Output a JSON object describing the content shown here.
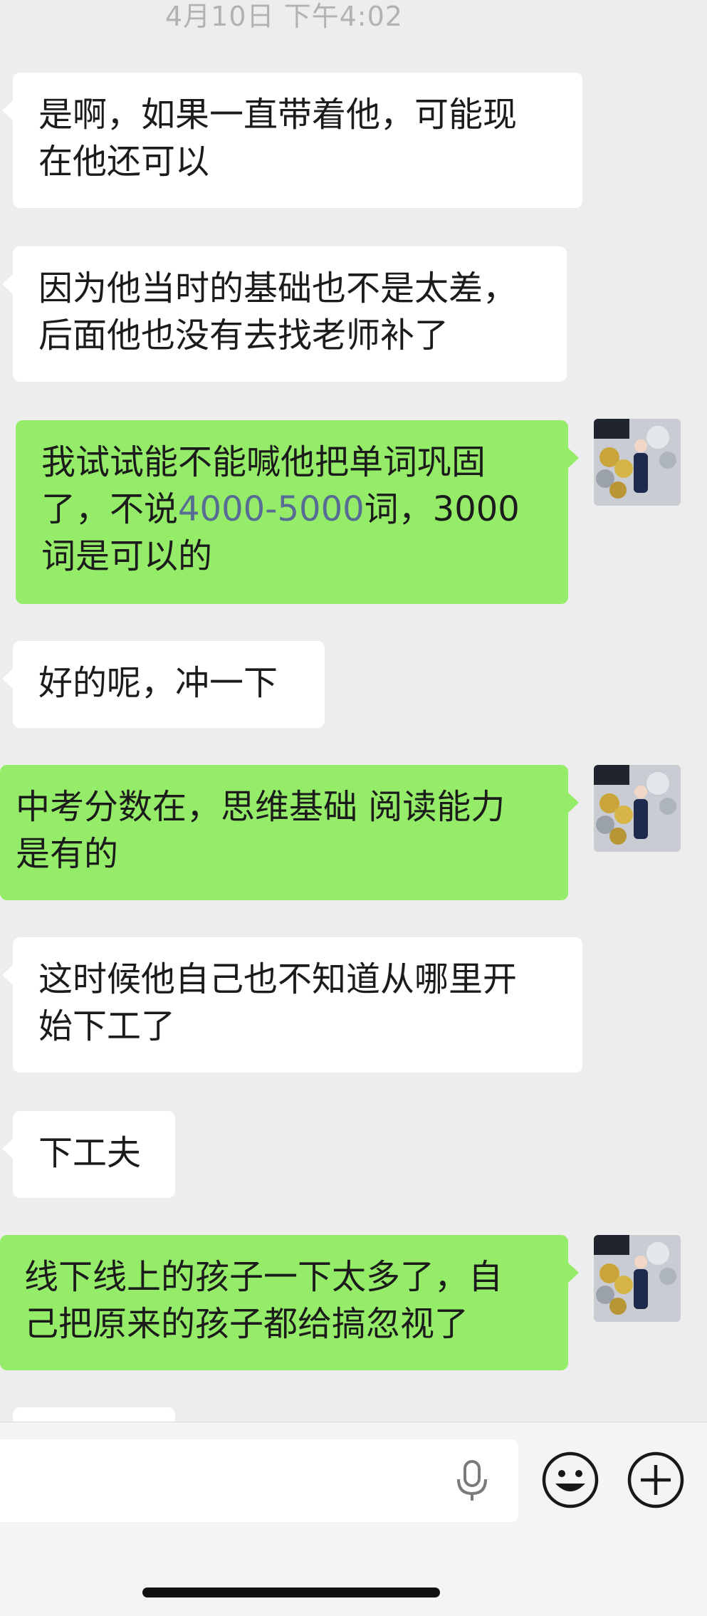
{
  "header": {
    "timestamp": "4月10日 下午4:02"
  },
  "messages": [
    {
      "side": "left",
      "text": "是啊，如果一直带着他，可能现\n在他还可以"
    },
    {
      "side": "left",
      "text": "因为他当时的基础也不是太差，\n后面他也没有去找老师补了"
    },
    {
      "side": "right",
      "text_before": "我试试能不能喊他把单词巩固\n了，不说",
      "highlight": "4000-5000",
      "text_after": "词，3000\n词是可以的"
    },
    {
      "side": "left",
      "text": "好的呢，冲一下"
    },
    {
      "side": "right",
      "text": "中考分数在，思维基础 阅读能力\n是有的"
    },
    {
      "side": "left",
      "text": "这时候他自己也不知道从哪里开\n始下工了"
    },
    {
      "side": "left",
      "text": "下工夫"
    },
    {
      "side": "right",
      "text": "线下线上的孩子一下太多了，自\n己把原来的孩子都给搞忽视了"
    }
  ],
  "input_bar": {
    "mic_icon": "microphone-icon",
    "emoji_icon": "smiley-face-icon",
    "plus_icon": "plus-circle-icon"
  },
  "colors": {
    "background": "#ededed",
    "left_bubble": "#ffffff",
    "right_bubble": "#95ec69",
    "link": "#576b95"
  }
}
